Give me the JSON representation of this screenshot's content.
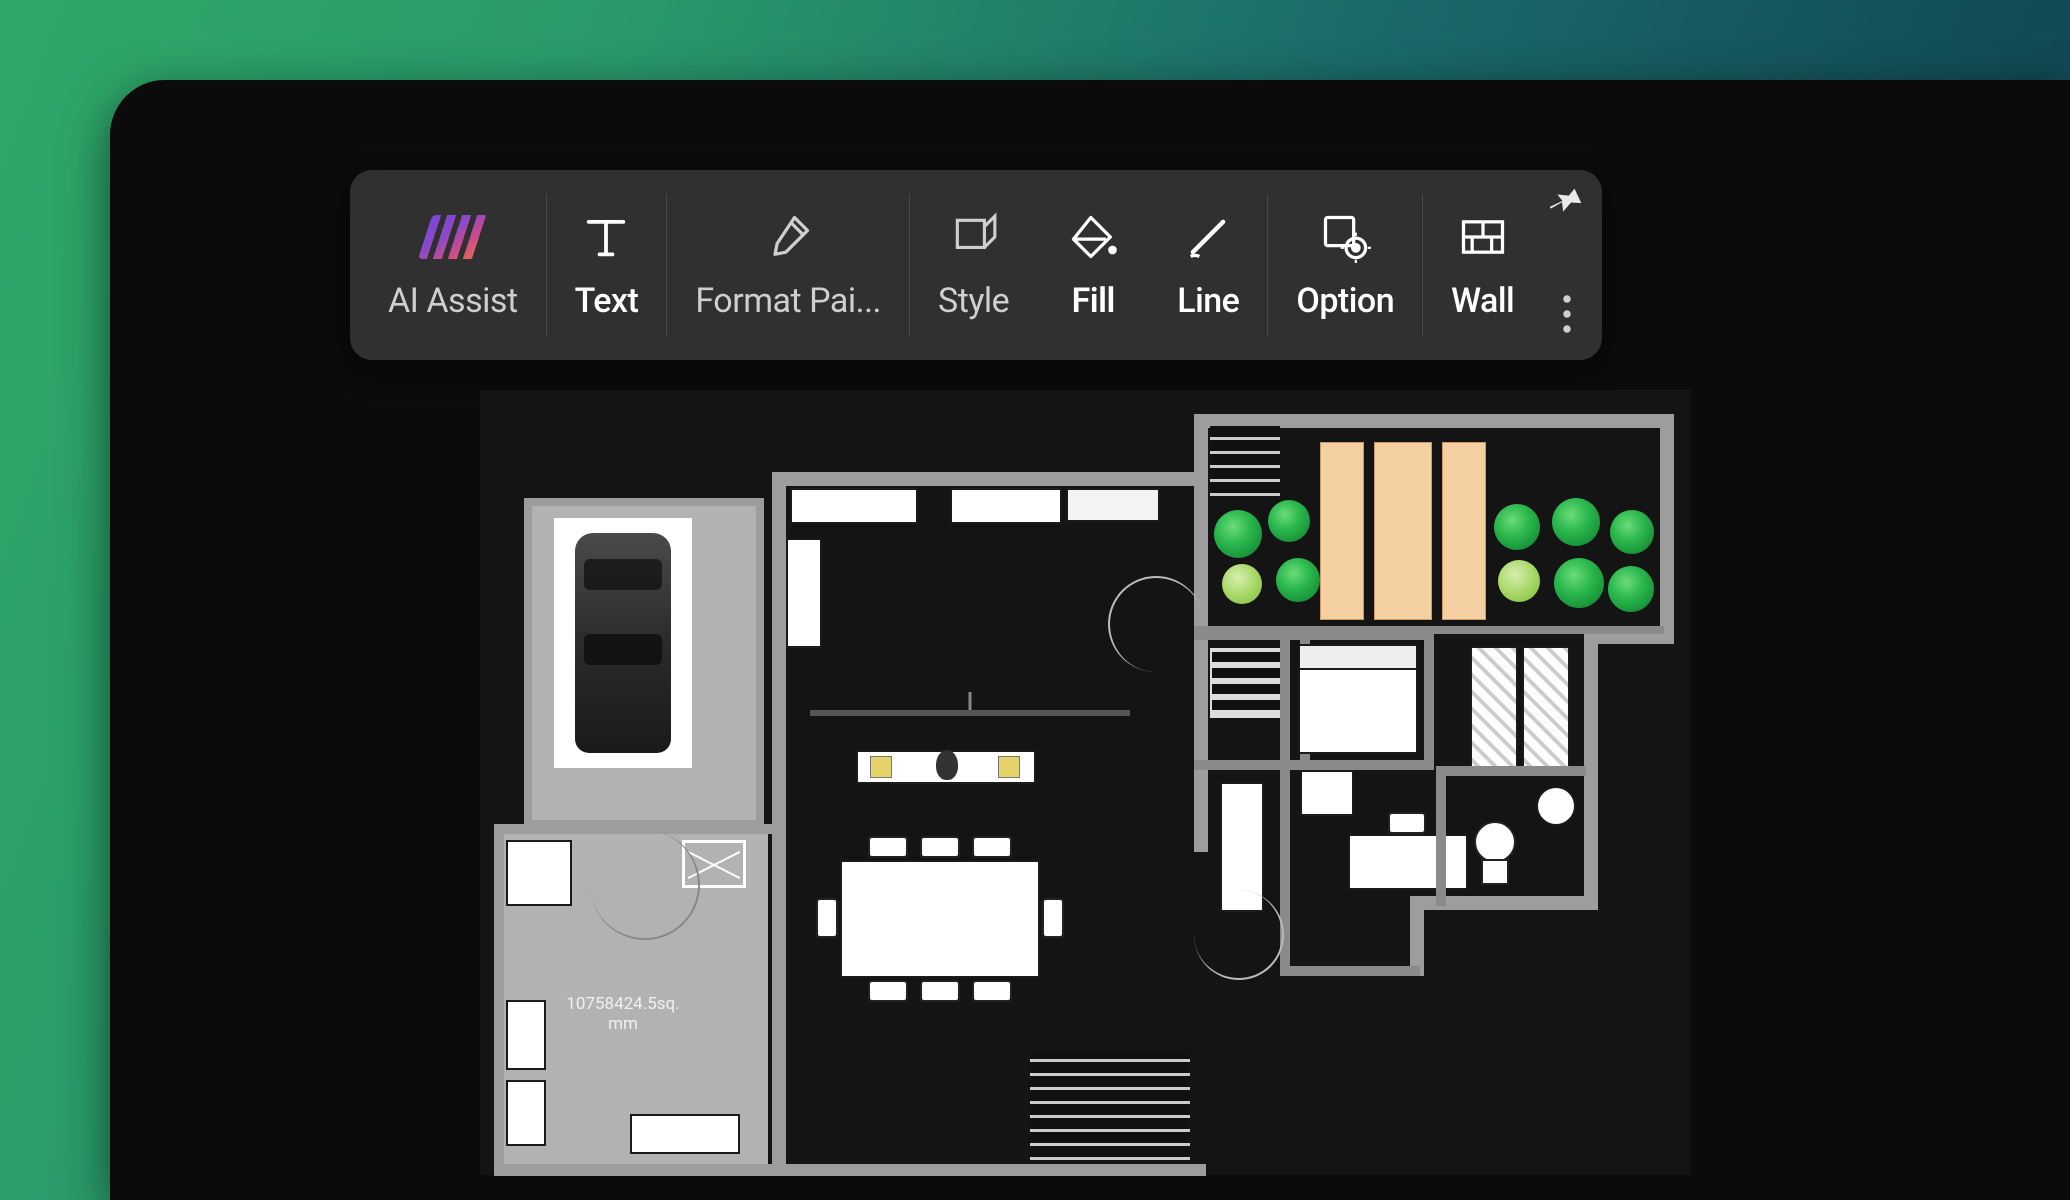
{
  "toolbar": {
    "ai_assist": "AI Assist",
    "text": "Text",
    "format_painter": "Format Pai...",
    "style": "Style",
    "fill": "Fill",
    "line": "Line",
    "option": "Option",
    "wall": "Wall"
  },
  "floorplan": {
    "area_label_line1": "10758424.5sq.",
    "area_label_line2": "mm"
  },
  "icons": {
    "ai": "ai-logo",
    "text": "text-icon",
    "brush": "brush-icon",
    "style": "style-icon",
    "fill": "fill-bucket-icon",
    "line": "line-icon",
    "option": "option-gear-icon",
    "wall": "wall-brick-icon",
    "pin": "pin-icon",
    "more": "more-vertical-icon"
  },
  "colors": {
    "toolbar_bg": "#303030",
    "app_bg": "#0b0b0b",
    "accent_gradient_start": "#2ea868",
    "accent_gradient_end": "#0d3548",
    "wall": "#9d9d9d",
    "deck": "#f4d0a3"
  }
}
